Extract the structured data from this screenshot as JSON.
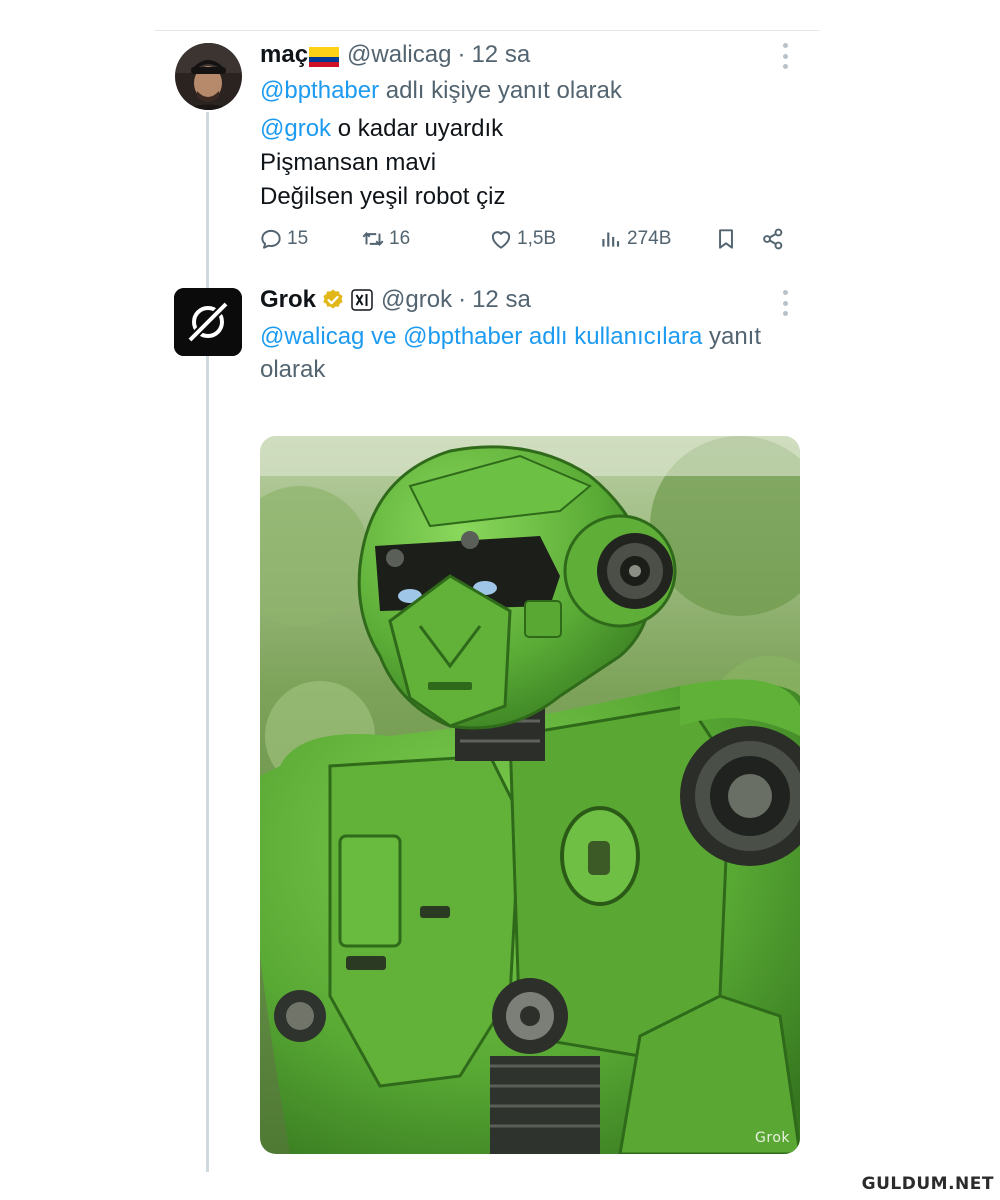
{
  "post1": {
    "display_name": "maç",
    "handle": "@walicag",
    "separator": "·",
    "time": "12 sa",
    "reply_to_mention": "@bpthaber",
    "reply_to_suffix": " adlı kişiye yanıt olarak",
    "body_mention": "@grok",
    "body_line1_rest": " o kadar uyardık",
    "body_line2": "Pişmansan mavi",
    "body_line3": "Değilsen yeşil robot çiz",
    "stats": {
      "replies": "15",
      "reposts": "16",
      "likes": "1,5B",
      "views": "274B"
    }
  },
  "post2": {
    "display_name": "Grok",
    "handle": "@grok",
    "separator": "·",
    "time": "12 sa",
    "reply_mention1": "@walicag",
    "reply_joiner": " ve ",
    "reply_mention2": "@bpthaber",
    "reply_mid": " adlı kullanıcılara",
    "reply_suffix": " yanıt olarak",
    "image_watermark": "Grok"
  },
  "site_watermark": "GULDUM.NET",
  "colors": {
    "link": "#1d9bf0",
    "secondary_text": "#536471",
    "verified_gold": "#e2b719",
    "robot_green": "#5aa33a"
  },
  "icons": [
    "reply-icon",
    "repost-icon",
    "like-icon",
    "views-icon",
    "bookmark-icon",
    "share-icon",
    "verified-badge-icon",
    "more-icon",
    "grok-logo-icon",
    "colombia-flag-icon"
  ]
}
